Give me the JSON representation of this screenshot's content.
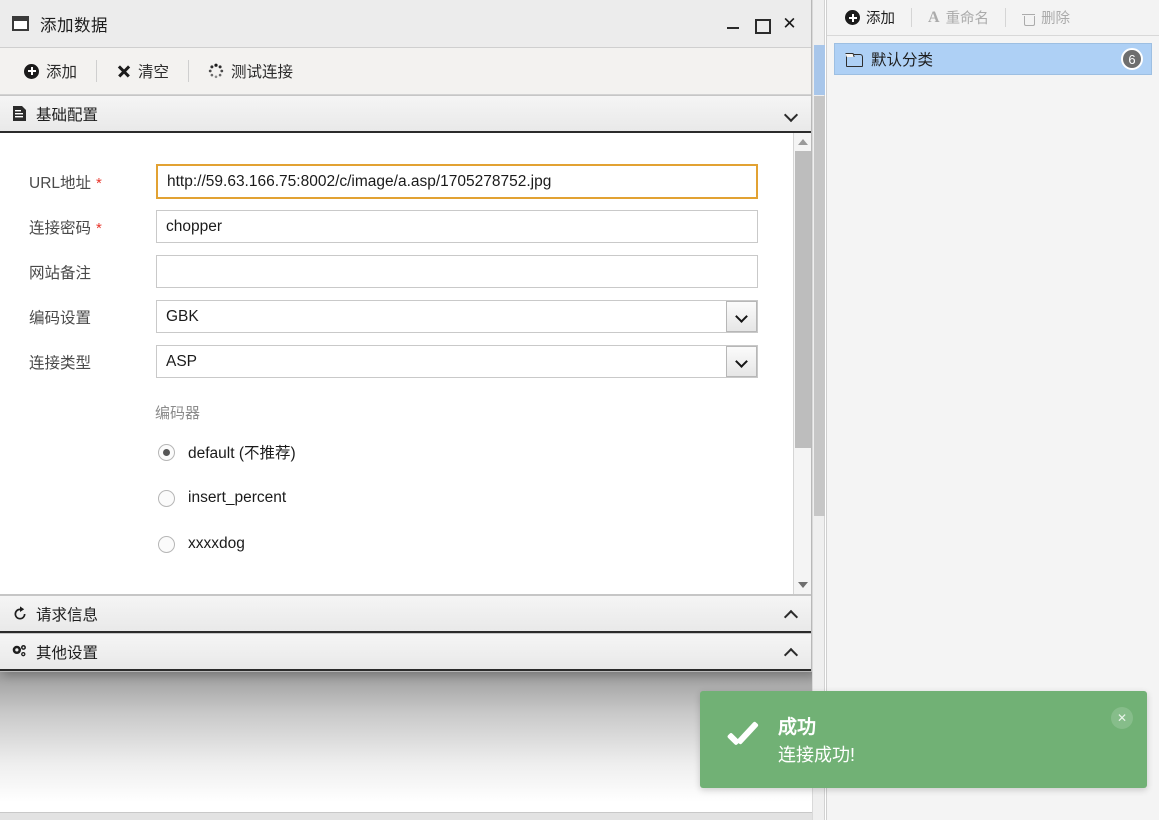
{
  "dialog": {
    "title": "添加数据",
    "window_buttons": {
      "minimize": "–",
      "maximize": "□",
      "close": "✕"
    },
    "toolbar": [
      {
        "label": "添加",
        "icon": "plus-circle-icon",
        "enabled": true
      },
      {
        "label": "清空",
        "icon": "x-icon",
        "enabled": true
      },
      {
        "label": "测试连接",
        "icon": "spinner-icon",
        "enabled": true
      }
    ],
    "sections": [
      {
        "id": "basic",
        "title": "基础配置",
        "icon": "document-icon",
        "expanded": true,
        "chevron": "chevron-down-icon"
      },
      {
        "id": "request",
        "title": "请求信息",
        "icon": "refresh-icon",
        "expanded": false,
        "chevron": "chevron-up-icon"
      },
      {
        "id": "other",
        "title": "其他设置",
        "icon": "gears-icon",
        "expanded": false,
        "chevron": "chevron-up-icon"
      }
    ],
    "form": {
      "fields": [
        {
          "label": "URL地址",
          "required": true,
          "type": "text",
          "value": "http://59.63.166.75:8002/c/image/a.asp/1705278752.jpg",
          "placeholder": "",
          "focused": true
        },
        {
          "label": "连接密码",
          "required": true,
          "type": "text",
          "value": "chopper",
          "placeholder": "",
          "focused": false
        },
        {
          "label": "网站备注",
          "required": false,
          "type": "text",
          "value": "",
          "placeholder": "",
          "focused": false
        },
        {
          "label": "编码设置",
          "required": false,
          "type": "select",
          "value": "GBK",
          "placeholder": "",
          "focused": false
        },
        {
          "label": "连接类型",
          "required": false,
          "type": "select",
          "value": "ASP",
          "placeholder": "",
          "focused": false
        }
      ],
      "encoder_group_label": "编码器",
      "encoder_options": [
        {
          "label": "default (不推荐)",
          "selected": true
        },
        {
          "label": "insert_percent",
          "selected": false
        },
        {
          "label": "xxxxdog",
          "selected": false
        }
      ]
    }
  },
  "right_panel": {
    "toolbar": [
      {
        "label": "添加",
        "icon": "plus-circle-icon",
        "enabled": true
      },
      {
        "label": "重命名",
        "icon": "rename-a-icon",
        "enabled": false
      },
      {
        "label": "删除",
        "icon": "trash-icon",
        "enabled": false
      }
    ],
    "rows": [
      {
        "label": "默认分类",
        "icon": "folder-icon",
        "badge": "6",
        "selected": true
      }
    ]
  },
  "toast": {
    "icon": "check-icon",
    "title": "成功",
    "message": "连接成功!",
    "close_label": "✕",
    "color": "#71b175"
  },
  "colors": {
    "accent_focus": "#e2a233",
    "selection": "#aed0f5",
    "toast_green": "#71b175",
    "required_red": "#e8352b"
  }
}
